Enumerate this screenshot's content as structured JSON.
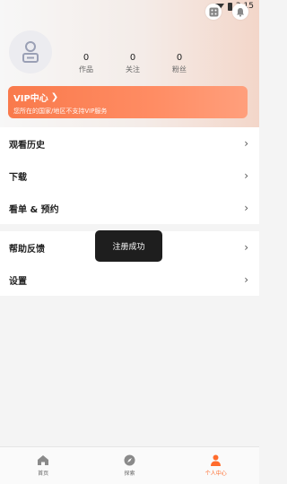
{
  "status": {
    "time": "3:15"
  },
  "profile": {
    "stats": [
      {
        "value": "0",
        "label": "作品"
      },
      {
        "value": "0",
        "label": "关注"
      },
      {
        "value": "0",
        "label": "粉丝"
      }
    ]
  },
  "vip": {
    "title": "VIP中心",
    "subtitle": "您所在的国家/地区不支持VIP服务"
  },
  "menu_group1": [
    {
      "label": "观看历史"
    },
    {
      "label": "下载"
    },
    {
      "label": "看单 & 预约"
    }
  ],
  "menu_group2": [
    {
      "label": "帮助反馈"
    },
    {
      "label": "设置"
    }
  ],
  "toast": {
    "text": "注册成功"
  },
  "tabs": [
    {
      "label": "首页",
      "icon": "home-icon"
    },
    {
      "label": "探索",
      "icon": "compass-icon"
    },
    {
      "label": "个人中心",
      "icon": "person-icon"
    }
  ],
  "colors": {
    "accent": "#ff6b2c",
    "vip_start": "#f97a4c",
    "vip_end": "#ff9f7c"
  }
}
